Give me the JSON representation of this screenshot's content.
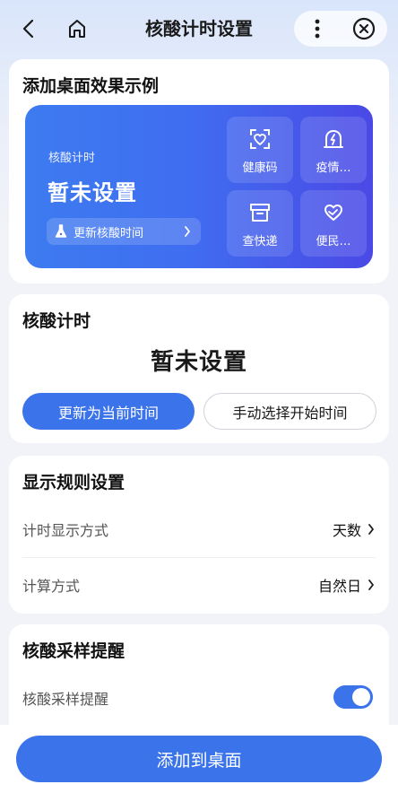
{
  "header": {
    "title": "核酸计时设置",
    "back_icon": "chevron-left-icon",
    "home_icon": "home-icon",
    "more_icon": "more-vertical-icon",
    "close_icon": "close-circle-icon"
  },
  "preview_section": {
    "title": "添加桌面效果示例",
    "widget": {
      "label": "核酸计时",
      "status": "暂未设置",
      "update_button": "更新核酸时间",
      "tiles": [
        {
          "label": "健康码",
          "icon": "health-code-heart-icon"
        },
        {
          "label": "疫情…",
          "icon": "epidemic-alert-icon"
        },
        {
          "label": "查快递",
          "icon": "package-box-icon"
        },
        {
          "label": "便民…",
          "icon": "service-heart-hand-icon"
        }
      ],
      "gradient": [
        "#3d7bf0",
        "#4b49e6"
      ]
    }
  },
  "timer_section": {
    "title": "核酸计时",
    "value": "暂未设置",
    "primary_button": "更新为当前时间",
    "secondary_button": "手动选择开始时间"
  },
  "rules_section": {
    "title": "显示规则设置",
    "rows": [
      {
        "label": "计时显示方式",
        "value": "天数"
      },
      {
        "label": "计算方式",
        "value": "自然日"
      }
    ]
  },
  "reminder_section": {
    "title": "核酸采样提醒",
    "toggle_label": "核酸采样提醒",
    "toggle_on": true
  },
  "footer": {
    "add_button": "添加到桌面"
  },
  "colors": {
    "accent": "#3a73ea",
    "background": "#f1f3f8"
  }
}
